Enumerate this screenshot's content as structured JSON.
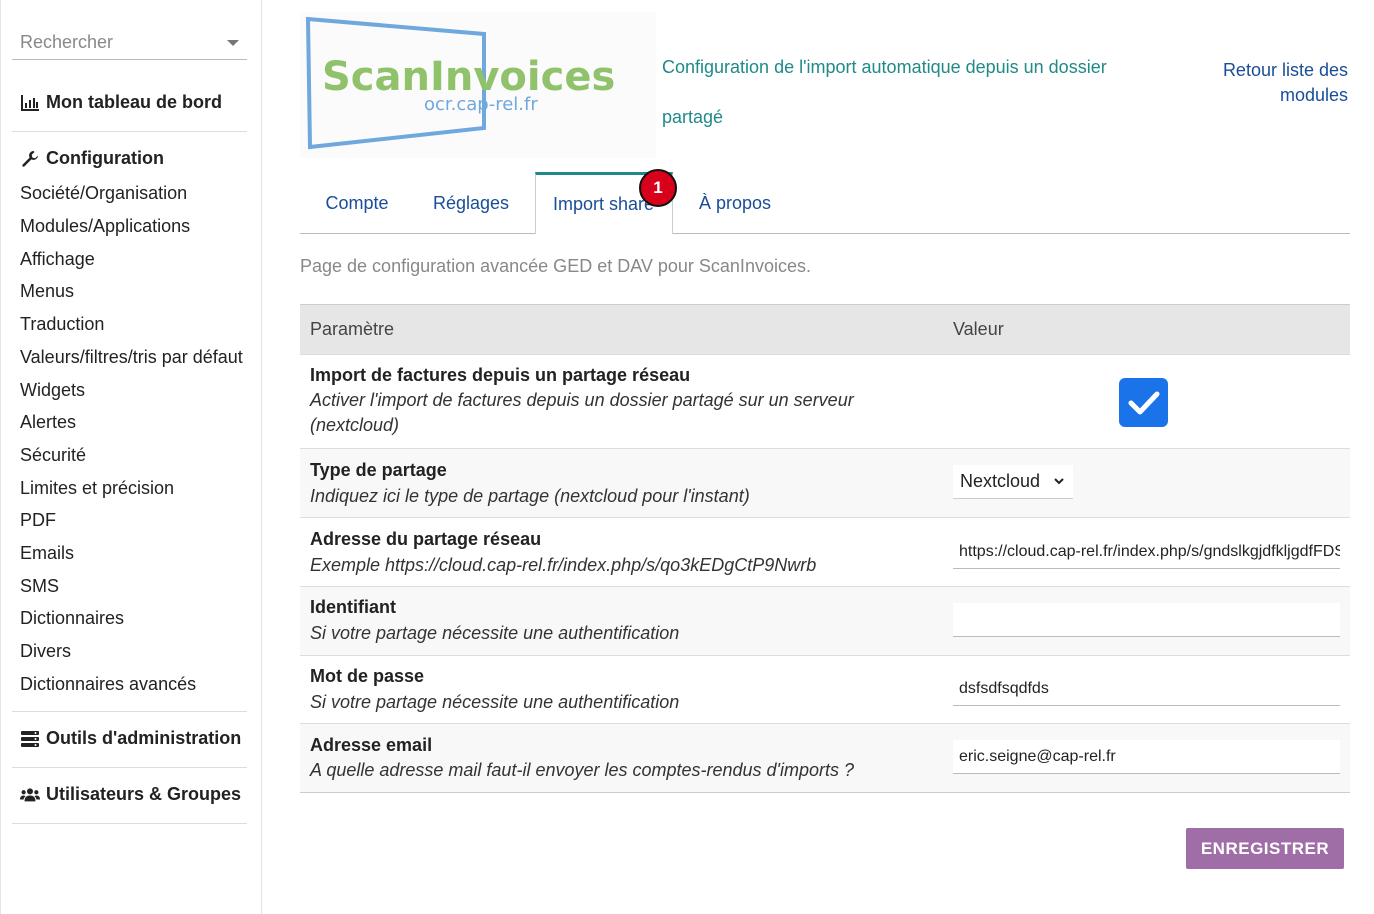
{
  "sidebar": {
    "search_placeholder": "Rechercher",
    "dashboard_label": "Mon tableau de bord",
    "config_label": "Configuration",
    "config_items": [
      "Société/Organisation",
      "Modules/Applications",
      "Affichage",
      "Menus",
      "Traduction",
      "Valeurs/filtres/tris par défaut",
      "Widgets",
      "Alertes",
      "Sécurité",
      "Limites et précision",
      "PDF",
      "Emails",
      "SMS",
      "Dictionnaires",
      "Divers",
      "Dictionnaires avancés"
    ],
    "admin_tools_label": "Outils d'administration",
    "users_groups_label": "Utilisateurs & Groupes"
  },
  "header": {
    "logo_text": "ScanInvoices",
    "logo_subtext": "ocr.cap-rel.fr",
    "title": "Configuration de l'import automatique depuis un dossier partagé",
    "back_link": "Retour liste des modules"
  },
  "tabs": [
    {
      "label": "Compte",
      "active": false
    },
    {
      "label": "Réglages",
      "active": false
    },
    {
      "label": "Import share",
      "active": true
    },
    {
      "label": "À propos",
      "active": false
    }
  ],
  "badge_count": "1",
  "description": "Page de configuration avancée GED et DAV pour ScanInvoices.",
  "table": {
    "col_param": "Paramètre",
    "col_value": "Valeur",
    "rows": [
      {
        "label": "Import de factures depuis un partage réseau",
        "help": "Activer l'import de factures depuis un dossier partagé sur un serveur (nextcloud)",
        "checked": true
      },
      {
        "label": "Type de partage",
        "help": "Indiquez ici le type de partage (nextcloud pour l'instant)",
        "value": "Nextcloud"
      },
      {
        "label": "Adresse du partage réseau",
        "help": "Exemple https://cloud.cap-rel.fr/index.php/s/qo3kEDgCtP9Nwrb",
        "value": "https://cloud.cap-rel.fr/index.php/s/gndslkgjdfkljgdfFDSfdsdsd"
      },
      {
        "label": "Identifiant",
        "help": "Si votre partage nécessite une authentification",
        "value": ""
      },
      {
        "label": "Mot de passe",
        "help": "Si votre partage nécessite une authentification",
        "value": "dsfsdfsqdfds"
      },
      {
        "label": "Adresse email",
        "help": "A quelle adresse mail faut-il envoyer les comptes-rendus d'imports ?",
        "value": "eric.seigne@cap-rel.fr"
      }
    ]
  },
  "save_button": "ENREGISTRER",
  "colors": {
    "accent_teal": "#1f8a88",
    "link_blue": "#1a4d99",
    "checkbox_blue": "#1a73e8",
    "save_purple": "#a06ea7",
    "badge_red": "#d9001b"
  }
}
